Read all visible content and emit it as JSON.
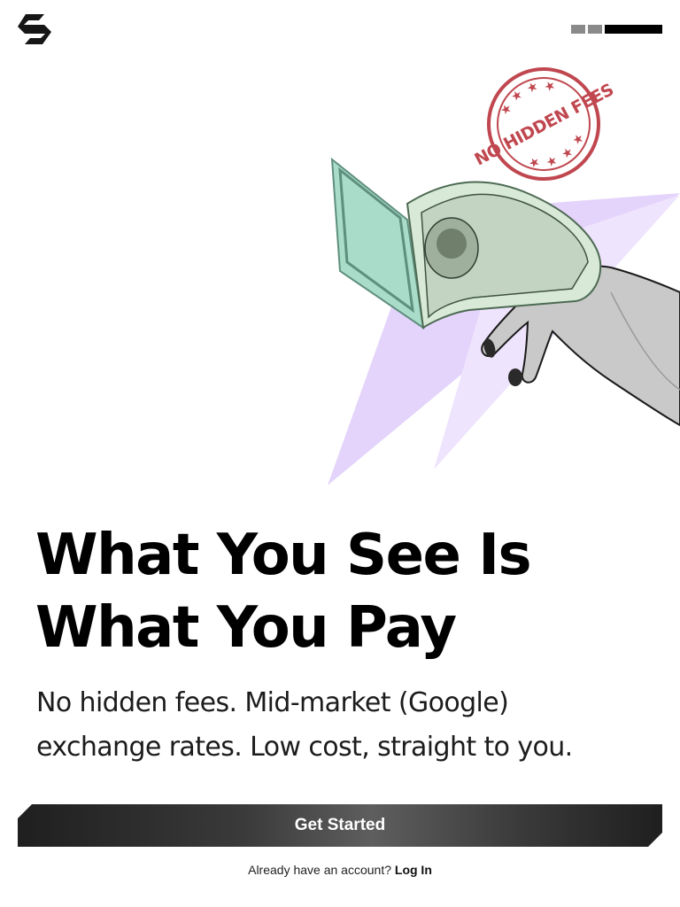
{
  "header": {
    "logo_icon": "brand-logo-icon",
    "progress": {
      "total_steps": 3,
      "current_step": 3,
      "active_color": "#000000",
      "inactive_color": "#8a8a8a"
    }
  },
  "hero": {
    "stamp_text": "NO HIDDEN FEES",
    "stamp_color": "#c0474f",
    "accent_color": "#e3d2fb"
  },
  "content": {
    "headline_line1": "What You See Is",
    "headline_line2": "What You Pay",
    "subtext_line1": "No hidden fees. Mid-market (Google)",
    "subtext_line2": "exchange rates. Low cost, straight to you."
  },
  "cta": {
    "label": "Get Started"
  },
  "login": {
    "prompt": "Already have an account?",
    "link_label": "Log In"
  }
}
